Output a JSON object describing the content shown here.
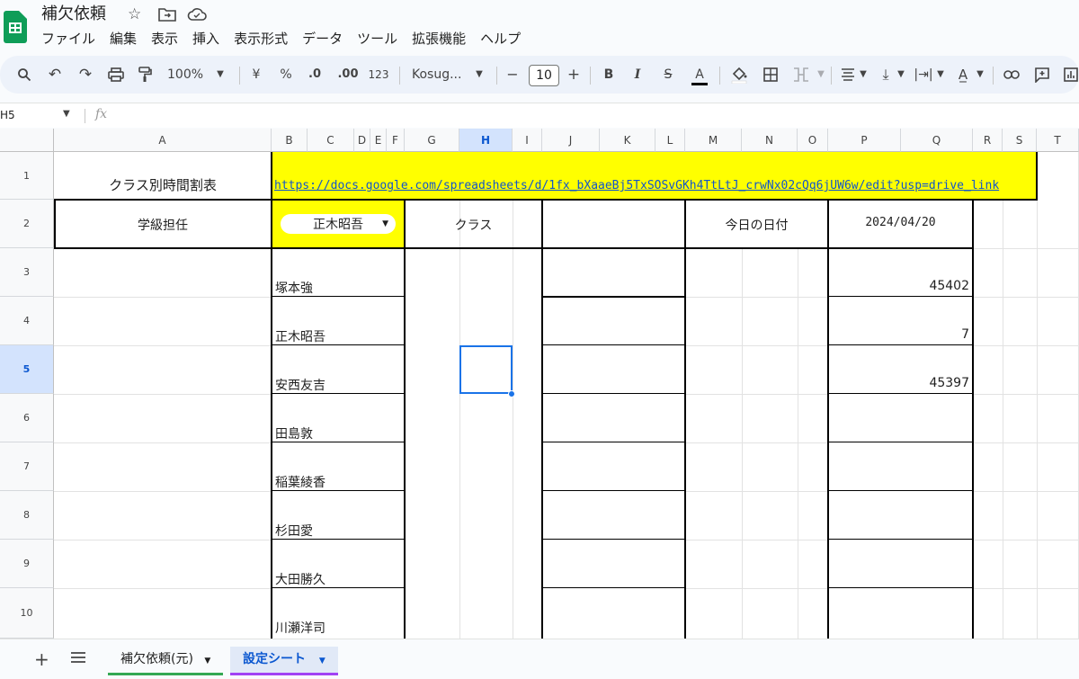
{
  "app": {
    "title": "補欠依頼"
  },
  "menu": [
    "ファイル",
    "編集",
    "表示",
    "挿入",
    "表示形式",
    "データ",
    "ツール",
    "拡張機能",
    "ヘルプ"
  ],
  "toolbar": {
    "zoom": "100%",
    "currency": "¥",
    "percent": "%",
    "dec_decrease": ".0",
    "dec_increase": ".00",
    "number_format": "123",
    "font": "Kosug...",
    "font_size": "10",
    "minus": "−",
    "plus": "+",
    "bold": "B",
    "italic": "I",
    "strike": "S",
    "text_color": "A"
  },
  "formula_bar": {
    "name_box": "H5",
    "fx": "fx"
  },
  "columns": [
    "A",
    "B",
    "C",
    "D",
    "E",
    "F",
    "G",
    "H",
    "I",
    "J",
    "K",
    "L",
    "M",
    "N",
    "O",
    "P",
    "Q",
    "R",
    "S",
    "T"
  ],
  "rows": [
    "1",
    "2",
    "3",
    "4",
    "5",
    "6",
    "7",
    "8",
    "9",
    "10"
  ],
  "cells": {
    "a1": "クラス別時間割表",
    "b1_link": "https://docs.google.com/spreadsheets/d/1fx_bXaaeBj5TxSOSvGKh4TtLtJ_crwNx02cQq6jUW6w/edit?usp=drive_link",
    "a2": "学級担任",
    "b2_dropdown": "正木昭吾",
    "g2": "クラス",
    "m2": "今日の日付",
    "p2": "2024/04/20",
    "b3": "塚本強",
    "b4": "正木昭吾",
    "b5": "安西友吉",
    "b6": "田島敦",
    "b7": "稲葉綾香",
    "b8": "杉田愛",
    "b9": "大田勝久",
    "b10": "川瀬洋司",
    "q3": "45402",
    "q4": "7",
    "q5": "45397"
  },
  "sheets": [
    {
      "name": "補欠依頼(元)",
      "color": "#34a853"
    },
    {
      "name": "設定シート",
      "color": "#a142f4"
    }
  ],
  "colors": {
    "highlight": "#ffff00",
    "link": "#1155cc",
    "selection": "#1a73e8"
  }
}
